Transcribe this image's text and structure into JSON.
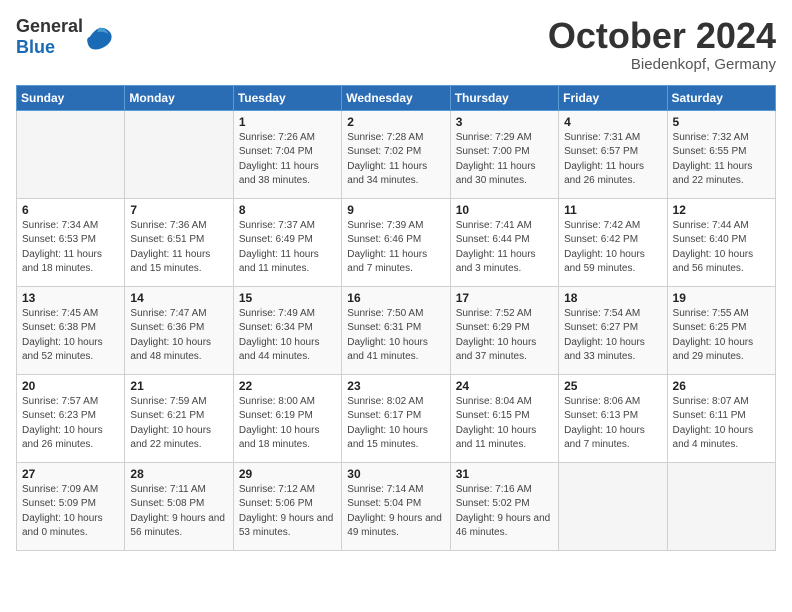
{
  "logo": {
    "general": "General",
    "blue": "Blue"
  },
  "header": {
    "month": "October 2024",
    "location": "Biedenkopf, Germany"
  },
  "weekdays": [
    "Sunday",
    "Monday",
    "Tuesday",
    "Wednesday",
    "Thursday",
    "Friday",
    "Saturday"
  ],
  "weeks": [
    [
      {
        "day": null
      },
      {
        "day": null
      },
      {
        "day": 1,
        "sunrise": "Sunrise: 7:26 AM",
        "sunset": "Sunset: 7:04 PM",
        "daylight": "Daylight: 11 hours and 38 minutes."
      },
      {
        "day": 2,
        "sunrise": "Sunrise: 7:28 AM",
        "sunset": "Sunset: 7:02 PM",
        "daylight": "Daylight: 11 hours and 34 minutes."
      },
      {
        "day": 3,
        "sunrise": "Sunrise: 7:29 AM",
        "sunset": "Sunset: 7:00 PM",
        "daylight": "Daylight: 11 hours and 30 minutes."
      },
      {
        "day": 4,
        "sunrise": "Sunrise: 7:31 AM",
        "sunset": "Sunset: 6:57 PM",
        "daylight": "Daylight: 11 hours and 26 minutes."
      },
      {
        "day": 5,
        "sunrise": "Sunrise: 7:32 AM",
        "sunset": "Sunset: 6:55 PM",
        "daylight": "Daylight: 11 hours and 22 minutes."
      }
    ],
    [
      {
        "day": 6,
        "sunrise": "Sunrise: 7:34 AM",
        "sunset": "Sunset: 6:53 PM",
        "daylight": "Daylight: 11 hours and 18 minutes."
      },
      {
        "day": 7,
        "sunrise": "Sunrise: 7:36 AM",
        "sunset": "Sunset: 6:51 PM",
        "daylight": "Daylight: 11 hours and 15 minutes."
      },
      {
        "day": 8,
        "sunrise": "Sunrise: 7:37 AM",
        "sunset": "Sunset: 6:49 PM",
        "daylight": "Daylight: 11 hours and 11 minutes."
      },
      {
        "day": 9,
        "sunrise": "Sunrise: 7:39 AM",
        "sunset": "Sunset: 6:46 PM",
        "daylight": "Daylight: 11 hours and 7 minutes."
      },
      {
        "day": 10,
        "sunrise": "Sunrise: 7:41 AM",
        "sunset": "Sunset: 6:44 PM",
        "daylight": "Daylight: 11 hours and 3 minutes."
      },
      {
        "day": 11,
        "sunrise": "Sunrise: 7:42 AM",
        "sunset": "Sunset: 6:42 PM",
        "daylight": "Daylight: 10 hours and 59 minutes."
      },
      {
        "day": 12,
        "sunrise": "Sunrise: 7:44 AM",
        "sunset": "Sunset: 6:40 PM",
        "daylight": "Daylight: 10 hours and 56 minutes."
      }
    ],
    [
      {
        "day": 13,
        "sunrise": "Sunrise: 7:45 AM",
        "sunset": "Sunset: 6:38 PM",
        "daylight": "Daylight: 10 hours and 52 minutes."
      },
      {
        "day": 14,
        "sunrise": "Sunrise: 7:47 AM",
        "sunset": "Sunset: 6:36 PM",
        "daylight": "Daylight: 10 hours and 48 minutes."
      },
      {
        "day": 15,
        "sunrise": "Sunrise: 7:49 AM",
        "sunset": "Sunset: 6:34 PM",
        "daylight": "Daylight: 10 hours and 44 minutes."
      },
      {
        "day": 16,
        "sunrise": "Sunrise: 7:50 AM",
        "sunset": "Sunset: 6:31 PM",
        "daylight": "Daylight: 10 hours and 41 minutes."
      },
      {
        "day": 17,
        "sunrise": "Sunrise: 7:52 AM",
        "sunset": "Sunset: 6:29 PM",
        "daylight": "Daylight: 10 hours and 37 minutes."
      },
      {
        "day": 18,
        "sunrise": "Sunrise: 7:54 AM",
        "sunset": "Sunset: 6:27 PM",
        "daylight": "Daylight: 10 hours and 33 minutes."
      },
      {
        "day": 19,
        "sunrise": "Sunrise: 7:55 AM",
        "sunset": "Sunset: 6:25 PM",
        "daylight": "Daylight: 10 hours and 29 minutes."
      }
    ],
    [
      {
        "day": 20,
        "sunrise": "Sunrise: 7:57 AM",
        "sunset": "Sunset: 6:23 PM",
        "daylight": "Daylight: 10 hours and 26 minutes."
      },
      {
        "day": 21,
        "sunrise": "Sunrise: 7:59 AM",
        "sunset": "Sunset: 6:21 PM",
        "daylight": "Daylight: 10 hours and 22 minutes."
      },
      {
        "day": 22,
        "sunrise": "Sunrise: 8:00 AM",
        "sunset": "Sunset: 6:19 PM",
        "daylight": "Daylight: 10 hours and 18 minutes."
      },
      {
        "day": 23,
        "sunrise": "Sunrise: 8:02 AM",
        "sunset": "Sunset: 6:17 PM",
        "daylight": "Daylight: 10 hours and 15 minutes."
      },
      {
        "day": 24,
        "sunrise": "Sunrise: 8:04 AM",
        "sunset": "Sunset: 6:15 PM",
        "daylight": "Daylight: 10 hours and 11 minutes."
      },
      {
        "day": 25,
        "sunrise": "Sunrise: 8:06 AM",
        "sunset": "Sunset: 6:13 PM",
        "daylight": "Daylight: 10 hours and 7 minutes."
      },
      {
        "day": 26,
        "sunrise": "Sunrise: 8:07 AM",
        "sunset": "Sunset: 6:11 PM",
        "daylight": "Daylight: 10 hours and 4 minutes."
      }
    ],
    [
      {
        "day": 27,
        "sunrise": "Sunrise: 7:09 AM",
        "sunset": "Sunset: 5:09 PM",
        "daylight": "Daylight: 10 hours and 0 minutes."
      },
      {
        "day": 28,
        "sunrise": "Sunrise: 7:11 AM",
        "sunset": "Sunset: 5:08 PM",
        "daylight": "Daylight: 9 hours and 56 minutes."
      },
      {
        "day": 29,
        "sunrise": "Sunrise: 7:12 AM",
        "sunset": "Sunset: 5:06 PM",
        "daylight": "Daylight: 9 hours and 53 minutes."
      },
      {
        "day": 30,
        "sunrise": "Sunrise: 7:14 AM",
        "sunset": "Sunset: 5:04 PM",
        "daylight": "Daylight: 9 hours and 49 minutes."
      },
      {
        "day": 31,
        "sunrise": "Sunrise: 7:16 AM",
        "sunset": "Sunset: 5:02 PM",
        "daylight": "Daylight: 9 hours and 46 minutes."
      },
      {
        "day": null
      },
      {
        "day": null
      }
    ]
  ]
}
